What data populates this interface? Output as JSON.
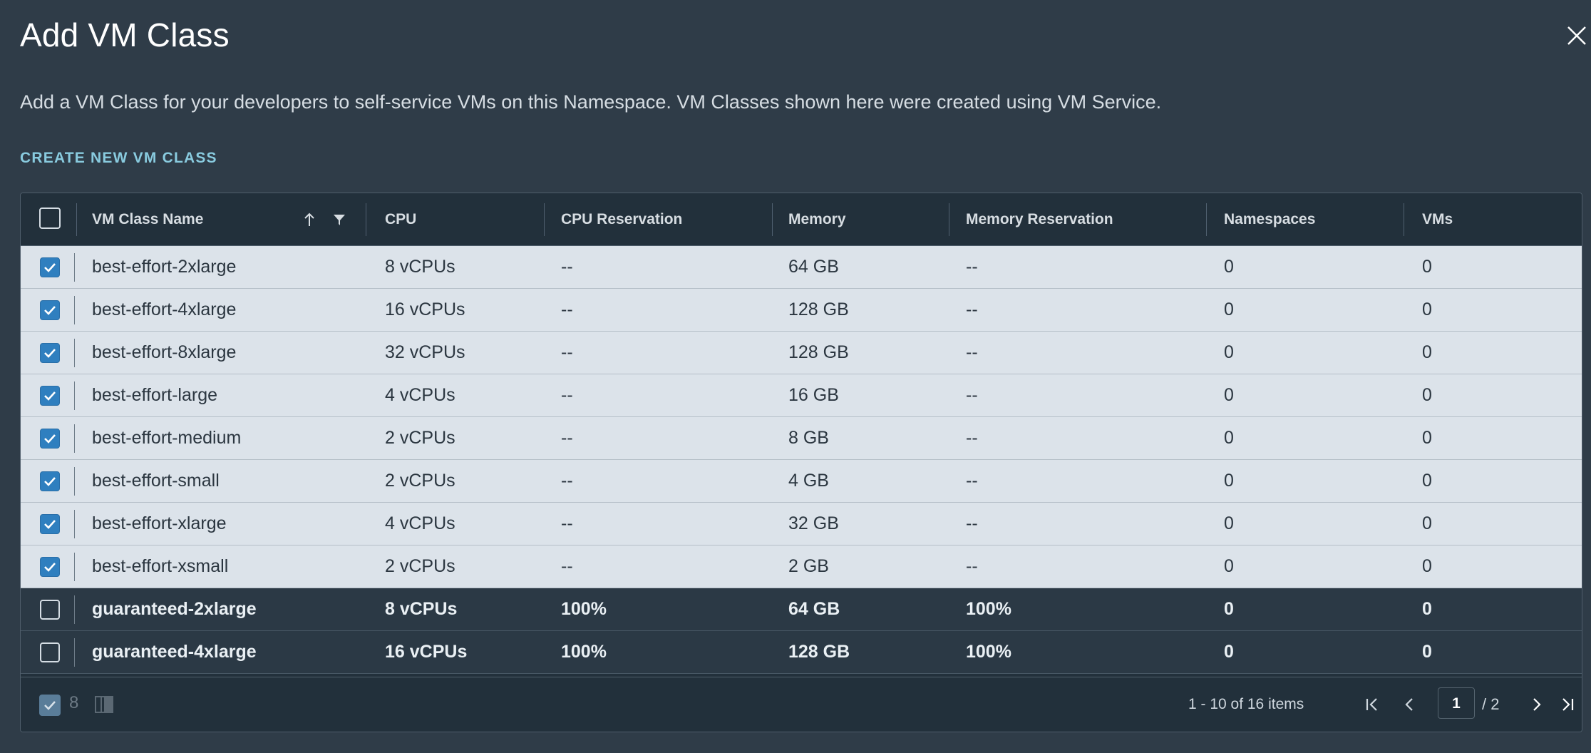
{
  "dialog": {
    "title": "Add VM Class",
    "description": "Add a VM Class for your developers to self-service VMs on this Namespace. VM Classes shown here were created using VM Service.",
    "create_link": "CREATE NEW VM CLASS",
    "close_icon": "close-icon"
  },
  "grid": {
    "columns": [
      "VM Class Name",
      "CPU",
      "CPU Reservation",
      "Memory",
      "Memory Reservation",
      "Namespaces",
      "VMs"
    ],
    "sort": "ascending",
    "rows": [
      {
        "selected": true,
        "name": "best-effort-2xlarge",
        "cpu": "8 vCPUs",
        "cpu_res": "--",
        "memory": "64 GB",
        "mem_res": "--",
        "namespaces": "0",
        "vms": "0"
      },
      {
        "selected": true,
        "name": "best-effort-4xlarge",
        "cpu": "16 vCPUs",
        "cpu_res": "--",
        "memory": "128 GB",
        "mem_res": "--",
        "namespaces": "0",
        "vms": "0"
      },
      {
        "selected": true,
        "name": "best-effort-8xlarge",
        "cpu": "32 vCPUs",
        "cpu_res": "--",
        "memory": "128 GB",
        "mem_res": "--",
        "namespaces": "0",
        "vms": "0"
      },
      {
        "selected": true,
        "name": "best-effort-large",
        "cpu": "4 vCPUs",
        "cpu_res": "--",
        "memory": "16 GB",
        "mem_res": "--",
        "namespaces": "0",
        "vms": "0"
      },
      {
        "selected": true,
        "name": "best-effort-medium",
        "cpu": "2 vCPUs",
        "cpu_res": "--",
        "memory": "8 GB",
        "mem_res": "--",
        "namespaces": "0",
        "vms": "0"
      },
      {
        "selected": true,
        "name": "best-effort-small",
        "cpu": "2 vCPUs",
        "cpu_res": "--",
        "memory": "4 GB",
        "mem_res": "--",
        "namespaces": "0",
        "vms": "0"
      },
      {
        "selected": true,
        "name": "best-effort-xlarge",
        "cpu": "4 vCPUs",
        "cpu_res": "--",
        "memory": "32 GB",
        "mem_res": "--",
        "namespaces": "0",
        "vms": "0"
      },
      {
        "selected": true,
        "name": "best-effort-xsmall",
        "cpu": "2 vCPUs",
        "cpu_res": "--",
        "memory": "2 GB",
        "mem_res": "--",
        "namespaces": "0",
        "vms": "0"
      },
      {
        "selected": false,
        "name": "guaranteed-2xlarge",
        "cpu": "8 vCPUs",
        "cpu_res": "100%",
        "memory": "64 GB",
        "mem_res": "100%",
        "namespaces": "0",
        "vms": "0"
      },
      {
        "selected": false,
        "name": "guaranteed-4xlarge",
        "cpu": "16 vCPUs",
        "cpu_res": "100%",
        "memory": "128 GB",
        "mem_res": "100%",
        "namespaces": "0",
        "vms": "0"
      }
    ]
  },
  "footer": {
    "selected_count": "8",
    "range_text": "1 - 10 of 16 items",
    "current_page": "1",
    "total_pages": "/ 2"
  },
  "colors": {
    "background": "#2f3c48",
    "selected_row": "#dce3ea",
    "checkbox_checked": "#2f7fbf",
    "link": "#89cbdf"
  }
}
